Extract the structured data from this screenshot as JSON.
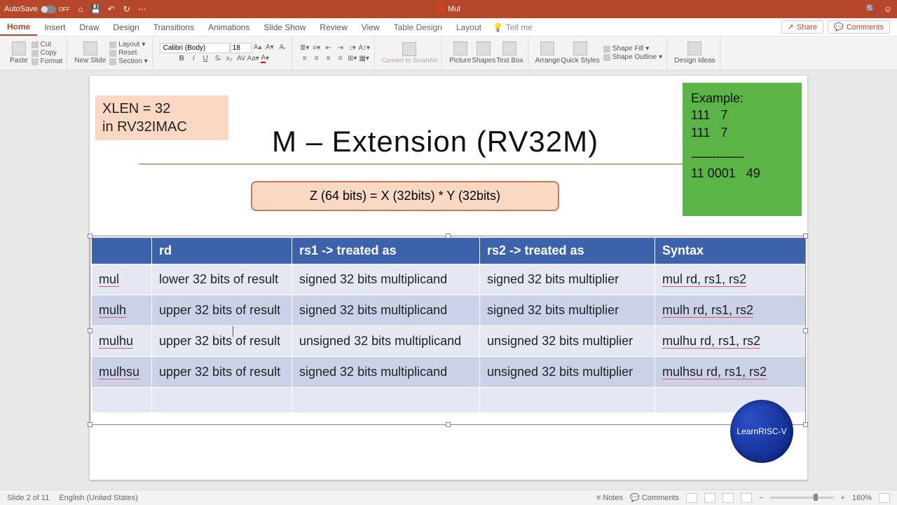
{
  "titlebar": {
    "autosave_label": "AutoSave",
    "autosave_state": "OFF",
    "doc_title": "Mul"
  },
  "tabs": {
    "items": [
      "Home",
      "Insert",
      "Draw",
      "Design",
      "Transitions",
      "Animations",
      "Slide Show",
      "Review",
      "View",
      "Table Design",
      "Layout"
    ],
    "active": 0,
    "tell_me": "Tell me",
    "share": "Share",
    "comments": "Comments"
  },
  "ribbon": {
    "paste": "Paste",
    "cut": "Cut",
    "copy": "Copy",
    "format": "Format",
    "new_slide": "New Slide",
    "layout": "Layout",
    "reset": "Reset",
    "section": "Section",
    "font_name": "Calibri (Body)",
    "font_size": "18",
    "convert": "Convert to SmartArt",
    "picture": "Picture",
    "shapes": "Shapes",
    "textbox": "Text Box",
    "arrange": "Arrange",
    "quick": "Quick Styles",
    "shape_fill": "Shape Fill",
    "shape_outline": "Shape Outline",
    "design_ideas": "Design Ideas"
  },
  "slide": {
    "note_line1": "XLEN = 32",
    "note_line2": "in RV32IMAC",
    "title": "M – Extension (RV32M)",
    "formula": "Z (64 bits) =  X (32bits)  *  Y (32bits)",
    "example_hdr": "Example:",
    "example_l1": "111   7",
    "example_l2": "111   7",
    "example_div": "---------------",
    "example_res": "11 0001   49",
    "badge": "LearnRISC-V",
    "table": {
      "headers": [
        "",
        "rd",
        "rs1 -> treated as",
        "rs2 -> treated as",
        "Syntax"
      ],
      "rows": [
        [
          "mul",
          "lower 32 bits of result",
          "signed 32 bits multiplicand",
          "signed 32 bits multiplier",
          "mul rd, rs1, rs2"
        ],
        [
          "mulh",
          "upper 32 bits of result",
          "signed 32 bits multiplicand",
          "signed 32 bits multiplier",
          "mulh rd, rs1, rs2"
        ],
        [
          "mulhu",
          "upper 32 bits of result",
          "unsigned 32 bits multiplicand",
          "unsigned 32 bits multiplier",
          "mulhu rd, rs1, rs2"
        ],
        [
          "mulhsu",
          "upper 32 bits of result",
          "signed 32 bits multiplicand",
          "unsigned 32 bits multiplier",
          "mulhsu rd, rs1, rs2"
        ]
      ]
    }
  },
  "status": {
    "slide_info": "Slide 2 of 11",
    "lang": "English (United States)",
    "notes": "Notes",
    "comments": "Comments",
    "zoom": "160%"
  }
}
